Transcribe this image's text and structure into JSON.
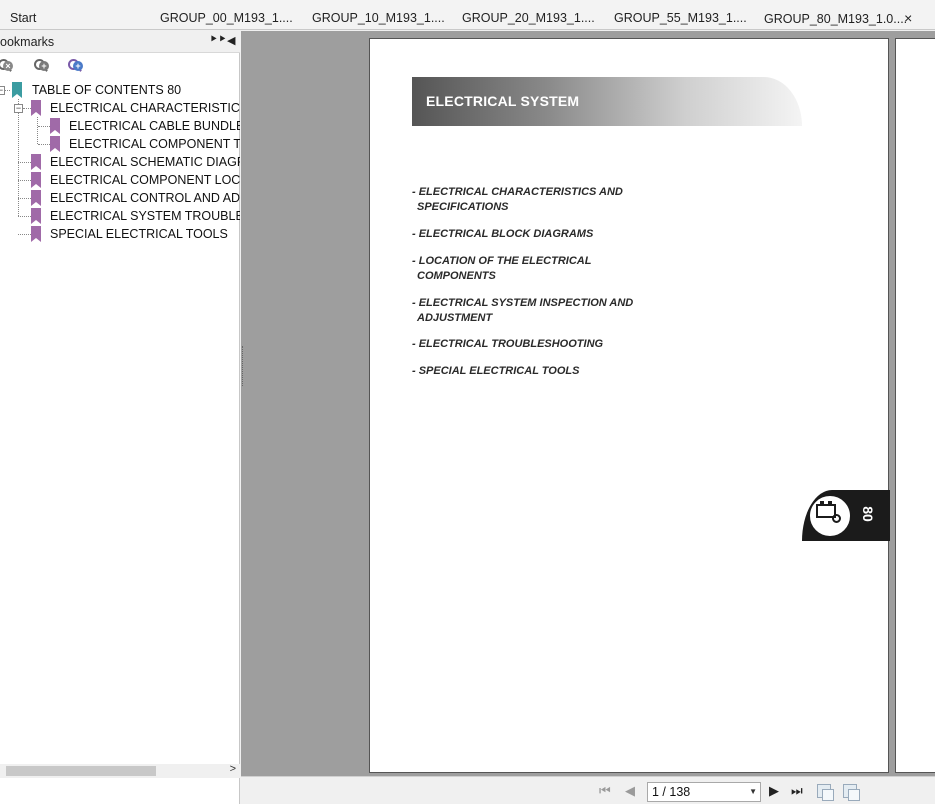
{
  "tabs": [
    {
      "label": "Start",
      "active": false
    },
    {
      "label": "GROUP_00_M193_1....",
      "active": false
    },
    {
      "label": "GROUP_10_M193_1....",
      "active": false
    },
    {
      "label": "GROUP_20_M193_1....",
      "active": false
    },
    {
      "label": "GROUP_55_M193_1....",
      "active": false
    },
    {
      "label": "GROUP_80_M193_1.0....",
      "active": true
    }
  ],
  "tab_close": "×",
  "sidebar": {
    "title": "ookmarks",
    "expand_btn": "⯈⯈",
    "collapse_btn": "◀",
    "tools": [
      "remove-bookmark-icon",
      "add-bookmark-icon",
      "bookmark-properties-icon"
    ],
    "tree": {
      "root": "TABLE OF CONTENTS 80",
      "items": [
        {
          "label": "ELECTRICAL CHARACTERISTICS A",
          "children": [
            "ELECTRICAL CABLE BUNDLES",
            "ELECTRICAL COMPONENT TEC"
          ]
        },
        {
          "label": "ELECTRICAL SCHEMATIC DIAGRAM",
          "children": []
        },
        {
          "label": "ELECTRICAL COMPONENT LOCATI",
          "children": []
        },
        {
          "label": "ELECTRICAL CONTROL AND ADJUS",
          "children": []
        },
        {
          "label": "ELECTRICAL SYSTEM TROUBLESH",
          "children": []
        },
        {
          "label": "SPECIAL ELECTRICAL TOOLS",
          "children": []
        }
      ]
    }
  },
  "document": {
    "header": "ELECTRICAL SYSTEM",
    "toc": [
      {
        "line1": "- ELECTRICAL CHARACTERISTICS AND",
        "line2": "SPECIFICATIONS"
      },
      {
        "line1": "- ELECTRICAL BLOCK DIAGRAMS",
        "line2": ""
      },
      {
        "line1": "- LOCATION OF THE ELECTRICAL",
        "line2": "COMPONENTS"
      },
      {
        "line1": "- ELECTRICAL SYSTEM INSPECTION AND",
        "line2": "ADJUSTMENT"
      },
      {
        "line1": "- ELECTRICAL TROUBLESHOOTING",
        "line2": ""
      },
      {
        "line1": "- SPECIAL ELECTRICAL TOOLS",
        "line2": ""
      }
    ],
    "section_tab": "80"
  },
  "status": {
    "first": "⏮",
    "prev": "◀",
    "page": "1 / 138",
    "next": "▶",
    "last": "⏭"
  }
}
